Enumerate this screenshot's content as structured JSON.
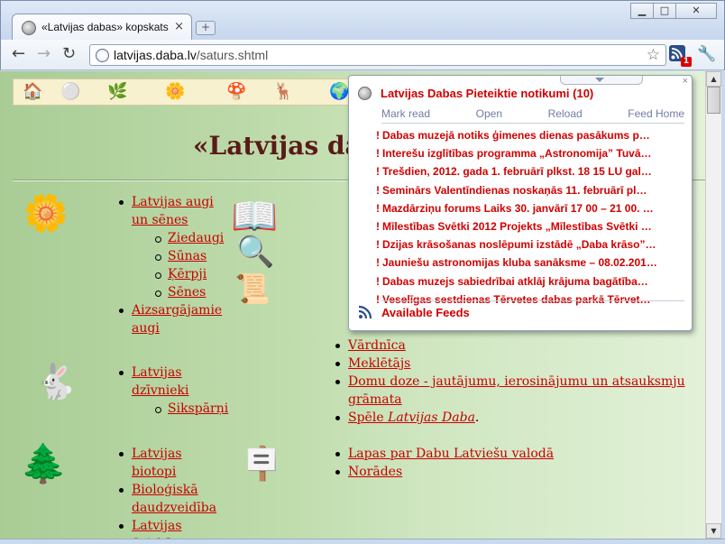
{
  "window": {
    "tab_title": "«Latvijas dabas» kopskats",
    "tab_close": "×",
    "new_tab": "+",
    "minimize": "▁",
    "maximize": "□",
    "close": "✕"
  },
  "toolbar": {
    "back": "←",
    "forward": "→",
    "reload": "↻",
    "url_host": "latvijas.daba.lv",
    "url_path": "/saturs.shtml",
    "star": "☆",
    "badge_count": "1",
    "wrench": "🔧"
  },
  "page": {
    "heading": "«Latvijas da",
    "column_left_1": [
      {
        "label": "Latvijas augi un sēnes",
        "sub": [
          "Ziedaugi",
          "Sūnas",
          "Ķērpji",
          "Sēnes"
        ]
      },
      {
        "label": "Aizsargājamie augi",
        "sub": []
      }
    ],
    "column_left_2": [
      {
        "label": "Latvijas dzīvnieki",
        "sub": [
          "Sikspārņi"
        ]
      }
    ],
    "column_left_3": [
      {
        "label": "Latvijas biotopi"
      },
      {
        "label": "Bioloģiskā daudzveidība"
      },
      {
        "label": "Latvijas fiziskā ģeogrāfija"
      }
    ],
    "column_right_1": [
      "Vārdnīca",
      "Meklētājs",
      "Domu doze - jautājumu, ierosinājumu un atsauksmju grāmata"
    ],
    "game_prefix": "Spēle ",
    "game_title": "Latvijas Daba",
    "game_suffix": ".",
    "column_right_2": [
      "Lapas par Dabu Latviešu valodā",
      "Norādes"
    ]
  },
  "feed_popup": {
    "title": "Latvijas Dabas Pieteiktie notikumi (10)",
    "close": "×",
    "actions": [
      "Mark read",
      "Open",
      "Reload",
      "Feed Home"
    ],
    "items": [
      "Dabas muzejā notiks ģimenes dienas pasākums p…",
      "Interešu izglītības programma „Astronomija” Tuvā…",
      "Trešdien, 2012. gada 1. februārī plkst. 18 15 LU gal…",
      "Seminārs Valentīndienas noskaņās 11. februārī pl…",
      "Mazdārziņu forums Laiks 30. janvārī 17 00 – 21 00. …",
      "Mīlestības Svētki 2012 Projekts „Mīlestības Svētki …",
      "Dzijas krāsošanas noslēpumi izstādē „Daba krāso”…",
      "Jauniešu astronomijas kluba sanāksme – 08.02.201…",
      "Dabas muzejs sabiedrībai atklāj krājuma bagātība…",
      "Veselīgas sestdienas Tērvetes dabas parkā Tērvet…"
    ],
    "footer": "Available Feeds"
  },
  "scrollbar": {
    "up": "▲",
    "down": "▼"
  },
  "colors": {
    "link": "#c80000",
    "feed_red": "#d10000",
    "heading": "#5a1a18"
  }
}
